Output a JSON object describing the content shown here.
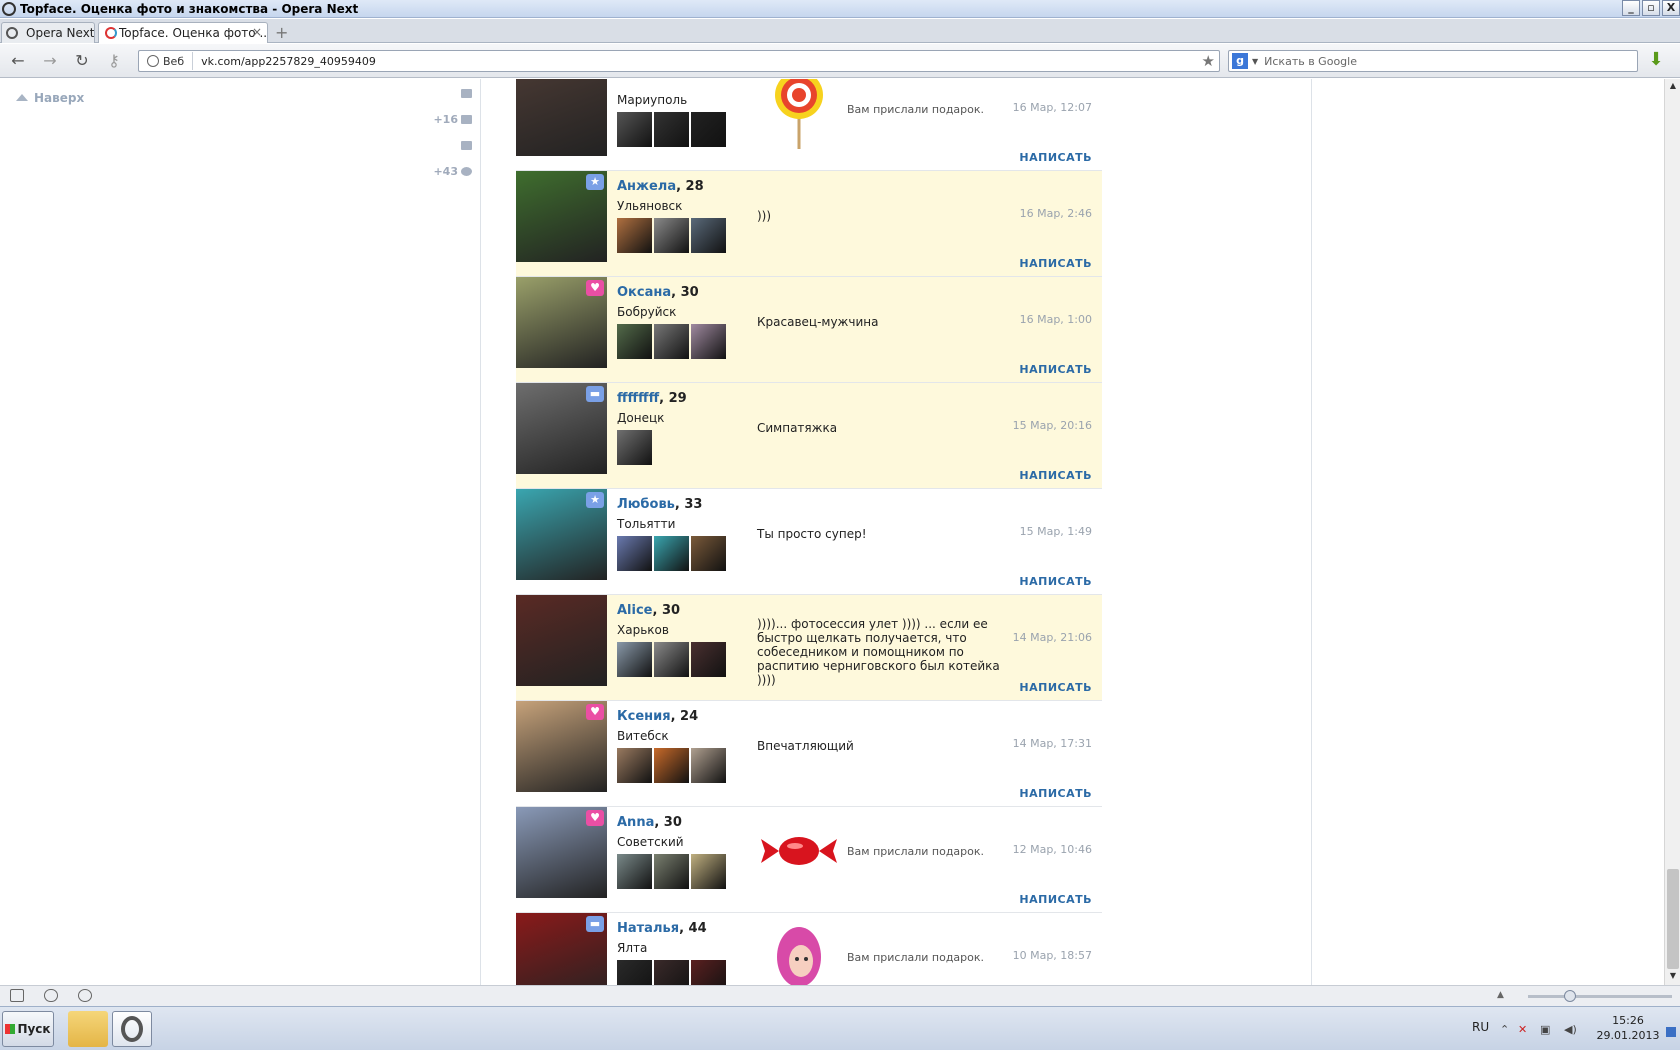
{
  "window": {
    "title": "Topface. Оценка фото и знакомства - Opera Next",
    "buttons": [
      "_",
      "▫",
      "X"
    ]
  },
  "tabs": [
    {
      "label": "Opera Next",
      "active": false
    },
    {
      "label": "Topface. Оценка фото ...",
      "active": true,
      "close": "×"
    }
  ],
  "newtab_symbol": "+",
  "nav": {
    "back": "←",
    "forward": "→",
    "reload": "↻",
    "key": "⚷",
    "web_label": "Веб",
    "url": "vk.com/app2257829_40959409",
    "bookmark_star": "★",
    "search_engine": "g",
    "search_placeholder": "Искать в Google",
    "download_icon": "⬇"
  },
  "sidebar": {
    "top_link": "Наверх",
    "stats": [
      {
        "text": "",
        "icon": "mail-icon"
      },
      {
        "text": "+16",
        "icon": "people-icon"
      },
      {
        "text": "",
        "icon": "comment-icon"
      },
      {
        "text": "+43",
        "icon": "gear-icon"
      }
    ]
  },
  "feed": [
    {
      "name": "",
      "age": "",
      "city": "Мариуполь",
      "message": "",
      "gift": "lollipop",
      "gift_text": "Вам прислали подарок.",
      "date": "16 Мар, 12:07",
      "action": "НАПИСАТЬ",
      "highlight": false,
      "badge": "",
      "avatar_color": "#4a3a34",
      "thumbs": [
        "#555",
        "#333",
        "#222"
      ]
    },
    {
      "name": "Анжела",
      "age": ", 28",
      "city": "Ульяновск",
      "message": ")))",
      "gift": "",
      "gift_text": "",
      "date": "16 Мар, 2:46",
      "action": "НАПИСАТЬ",
      "highlight": true,
      "badge": "star",
      "avatar_color": "#3f6e2e",
      "thumbs": [
        "#b07040",
        "#8a8a8a",
        "#5a6a7a"
      ]
    },
    {
      "name": "Оксана",
      "age": ", 30",
      "city": "Бобруйск",
      "message": "Красавец-мужчина",
      "gift": "",
      "gift_text": "",
      "date": "16 Мар, 1:00",
      "action": "НАПИСАТЬ",
      "highlight": true,
      "badge": "heart",
      "avatar_color": "#9aa06a",
      "thumbs": [
        "#536b4a",
        "#777",
        "#a08aa0"
      ]
    },
    {
      "name": "ffffffff",
      "age": ", 29",
      "city": "Донецк",
      "message": "Симпатяжка",
      "gift": "",
      "gift_text": "",
      "date": "15 Мар, 20:16",
      "action": "НАПИСАТЬ",
      "highlight": true,
      "badge": "msg",
      "avatar_color": "#6e6e6e",
      "thumbs": [
        "#707070"
      ]
    },
    {
      "name": "Любовь",
      "age": ", 33",
      "city": "Тольятти",
      "message": "Ты просто супер!",
      "gift": "",
      "gift_text": "",
      "date": "15 Мар, 1:49",
      "action": "НАПИСАТЬ",
      "highlight": false,
      "badge": "star",
      "avatar_color": "#3aa6b0",
      "thumbs": [
        "#6a7ab0",
        "#3aa6b0",
        "#7a5a3a"
      ]
    },
    {
      "name": "Alice",
      "age": ", 30",
      "city": "Харьков",
      "message": "))))... фотосессия улет )))) ... если ее быстро щелкать получается, что собеседником и помощником по распитию черниговского был котейка ))))",
      "gift": "",
      "gift_text": "",
      "date": "14 Мар, 21:06",
      "action": "НАПИСАТЬ",
      "highlight": true,
      "badge": "",
      "avatar_color": "#5a2a24",
      "thumbs": [
        "#8a9aaa",
        "#8a8a8a",
        "#4a3030"
      ]
    },
    {
      "name": "Ксения",
      "age": ", 24",
      "city": "Витебск",
      "message": "Впечатляющий",
      "gift": "",
      "gift_text": "",
      "date": "14 Мар, 17:31",
      "action": "НАПИСАТЬ",
      "highlight": false,
      "badge": "heart",
      "avatar_color": "#c6a27a",
      "thumbs": [
        "#9a7a60",
        "#c86a2a",
        "#b0a090"
      ]
    },
    {
      "name": "Anna",
      "age": ", 30",
      "city": "Советский",
      "message": "",
      "gift": "candy",
      "gift_text": "Вам прислали подарок.",
      "date": "12 Мар, 10:46",
      "action": "НАПИСАТЬ",
      "highlight": false,
      "badge": "heart",
      "avatar_color": "#8a9ab8",
      "thumbs": [
        "#7a8a8a",
        "#7a8070",
        "#c0b080"
      ]
    },
    {
      "name": "Наталья",
      "age": ", 44",
      "city": "Ялта",
      "message": "",
      "gift": "girl",
      "gift_text": "Вам прислали подарок.",
      "date": "10 Мар, 18:57",
      "action": "",
      "highlight": false,
      "badge": "msg",
      "avatar_color": "#8a1a1a",
      "thumbs": [
        "#2a2a2a",
        "#3a2a2a",
        "#5a2020"
      ]
    }
  ],
  "taskbar": {
    "start_label": "Пуск",
    "lang": "RU",
    "time": "15:26",
    "date": "29.01.2013"
  }
}
